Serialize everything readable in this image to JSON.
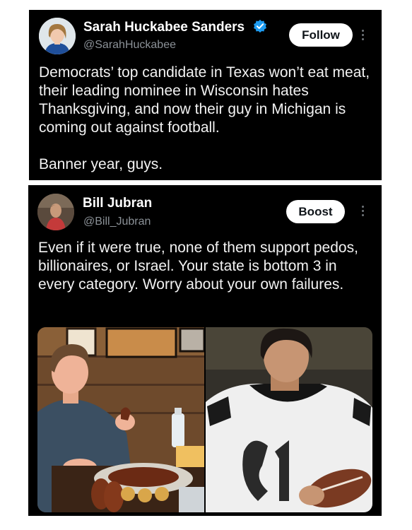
{
  "posts": [
    {
      "author": {
        "name": "Sarah Huckabee Sanders",
        "handle": "@SarahHuckabee",
        "verified": true
      },
      "action_label": "Follow",
      "text": "Democrats’ top candidate in Texas won’t eat meat, their leading nominee in Wisconsin hates Thanksgiving, and now their guy in Michigan is coming out against football.\n\nBanner year, guys."
    },
    {
      "author": {
        "name": "Bill Jubran",
        "handle": "@Bill_Jubran"
      },
      "action_label": "Boost",
      "text": "Even if it were true, none of them support pedos, billionaires, or Israel. Your state is bottom 3 in every category. Worry about your own failures.",
      "media": {
        "left_photo": "man-eating-barbecue",
        "right_photo": "football-player-portrait",
        "jersey_number": "61"
      }
    }
  ],
  "icons": {
    "verified": "verified-badge-icon",
    "more": "more-options-icon"
  },
  "colors": {
    "card_background": "#000000",
    "page_background": "#ffffff",
    "verified_blue": "#1d9bf0",
    "handle_gray": "#8b9197"
  }
}
